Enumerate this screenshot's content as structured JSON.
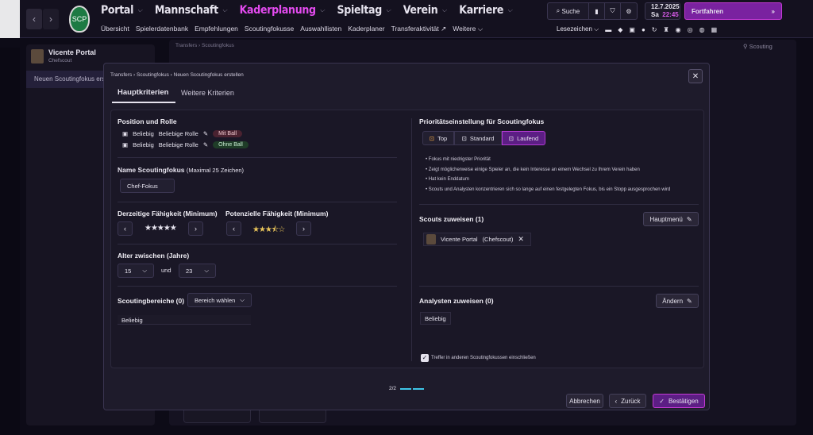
{
  "topnav": {
    "items": [
      {
        "label": "Portal"
      },
      {
        "label": "Mannschaft"
      },
      {
        "label": "Kaderplanung"
      },
      {
        "label": "Spieltag"
      },
      {
        "label": "Verein"
      },
      {
        "label": "Karriere"
      }
    ],
    "sub": [
      "Übersicht",
      "Spielerdatenbank",
      "Empfehlungen",
      "Scoutingfokusse",
      "Auswahllisten",
      "Kaderplaner",
      "Transferaktivität",
      "Weitere"
    ],
    "search": "Suche",
    "date": "12.7.2025",
    "day": "Sa",
    "time": "22:45",
    "continue": "Fortfahren",
    "bookmarks": "Lesezeichen",
    "accent": "#e44bf0"
  },
  "left": {
    "name": "Vicente Portal",
    "role": "Chefscout",
    "item": "Neuen Scoutingfokus erstell"
  },
  "bg": {
    "breadcrumb": [
      "Transfers",
      "Scoutingfokus"
    ],
    "scouting": "Scouting"
  },
  "modal": {
    "breadcrumb": [
      "Transfers",
      "Scoutingfokus",
      "Neuen Scoutingfokus erstellen"
    ],
    "tabs": [
      "Hauptkriterien",
      "Weitere Kriterien"
    ],
    "position": {
      "title": "Position und Rolle",
      "rows": [
        {
          "pos": "Beliebig",
          "role": "Beliebige Rolle",
          "tag": "Mit Ball"
        },
        {
          "pos": "Beliebig",
          "role": "Beliebige Rolle",
          "tag": "Ohne Ball"
        }
      ]
    },
    "name": {
      "title": "Name Scoutingfokus",
      "hint": "(Maximal 25 Zeichen)",
      "value": "Chef-Fokus"
    },
    "cur": {
      "title": "Derzeitige Fähigkeit (Minimum)",
      "stars": "★★★★★"
    },
    "pot": {
      "title": "Potenzielle Fähigkeit (Minimum)",
      "stars": "★★★⯪☆"
    },
    "age": {
      "title": "Alter zwischen (Jahre)",
      "from": "15",
      "and": "und",
      "to": "23"
    },
    "areas": {
      "title": "Scoutingbereiche (0)",
      "btn": "Bereich wählen",
      "value": "Beliebig"
    },
    "priority": {
      "title": "Prioritätseinstellung für Scoutingfokus",
      "options": [
        "Top",
        "Standard",
        "Laufend"
      ],
      "bullets": [
        "Fokus mit niedrigster Priorität",
        "Zeigt möglicherweise einige Spieler an, die kein Interesse an einem Wechsel zu Ihrem Verein haben",
        "Hat kein Enddatum",
        "Scouts und Analysten konzentrieren sich so lange auf einen festgelegten Fokus, bis ein Stopp ausgesprochen wird"
      ]
    },
    "scouts": {
      "title": "Scouts zuweisen (1)",
      "btn": "Hauptmenü",
      "name": "Vicente Portal",
      "role": "(Chefscout)"
    },
    "analysts": {
      "title": "Analysten zuweisen (0)",
      "btn": "Ändern",
      "value": "Beliebig"
    },
    "check": "Treffer in anderen Scoutingfokussen einschließen",
    "page": "2/2",
    "cancel": "Abbrechen",
    "back": "Zurück",
    "confirm": "Bestätigen"
  }
}
